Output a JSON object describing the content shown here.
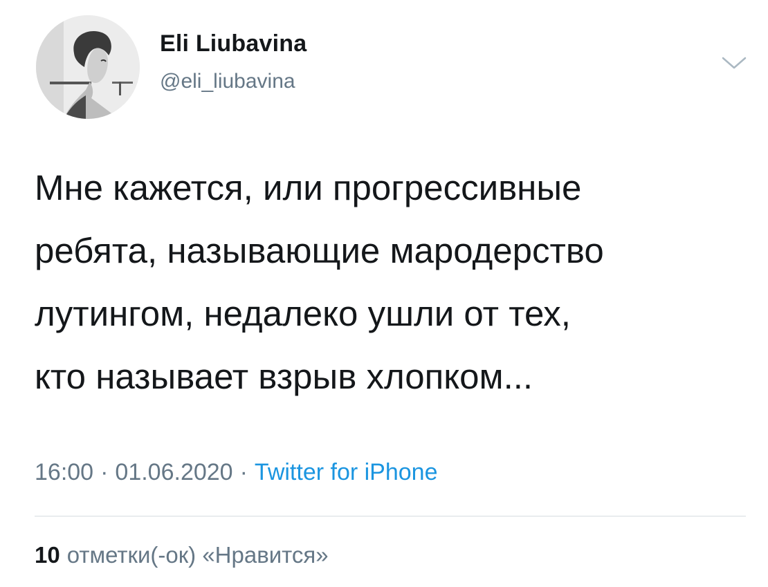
{
  "author": {
    "name": "Eli Liubavina",
    "handle": "@eli_liubavina",
    "avatar_icon": "profile-photo"
  },
  "tweet": {
    "lines": [
      "Мне кажется, или прогрессивные",
      "ребята, называющие мародерство",
      "лутингом, недалеко ушли от тех,",
      "кто называет взрыв хлопком..."
    ]
  },
  "meta": {
    "time": "16:00",
    "date": "01.06.2020",
    "separator": "·",
    "source": "Twitter for iPhone"
  },
  "likes": {
    "count": "10",
    "label": "отметки(-ок) «Нравится»"
  },
  "colors": {
    "text": "#14171a",
    "secondary": "#657786",
    "link": "#1b95e0",
    "divider": "#d6dbe0"
  },
  "icons": {
    "menu": "chevron-down-icon"
  }
}
